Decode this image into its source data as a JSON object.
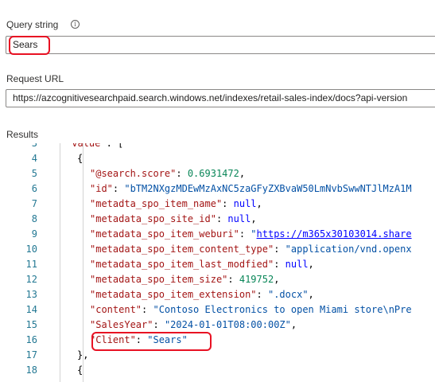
{
  "query": {
    "label": "Query string",
    "info_icon": "info-icon",
    "value": "Sears"
  },
  "request": {
    "label": "Request URL",
    "value": "https://azcognitivesearchpaid.search.windows.net/indexes/retail-sales-index/docs?api-version"
  },
  "results": {
    "label": "Results",
    "lines": [
      {
        "num": "3",
        "indent": 1,
        "parts": [
          {
            "t": "\"value\"",
            "c": "k"
          },
          {
            "t": ": [",
            "c": "p"
          }
        ]
      },
      {
        "num": "4",
        "indent": 2,
        "parts": [
          {
            "t": "{",
            "c": "p"
          }
        ]
      },
      {
        "num": "5",
        "indent": 3,
        "parts": [
          {
            "t": "\"@search.score\"",
            "c": "k"
          },
          {
            "t": ": ",
            "c": "p"
          },
          {
            "t": "0.6931472",
            "c": "n"
          },
          {
            "t": ",",
            "c": "p"
          }
        ]
      },
      {
        "num": "6",
        "indent": 3,
        "parts": [
          {
            "t": "\"id\"",
            "c": "k"
          },
          {
            "t": ": ",
            "c": "p"
          },
          {
            "t": "\"bTM2NXgzMDEwMzAxNC5zaGFyZXBvaW50LmNvbSwwNTJlMzA1M",
            "c": "s"
          }
        ]
      },
      {
        "num": "7",
        "indent": 3,
        "parts": [
          {
            "t": "\"metadta_spo_item_name\"",
            "c": "k"
          },
          {
            "t": ": ",
            "c": "p"
          },
          {
            "t": "null",
            "c": "kw"
          },
          {
            "t": ",",
            "c": "p"
          }
        ]
      },
      {
        "num": "8",
        "indent": 3,
        "parts": [
          {
            "t": "\"metadata_spo_site_id\"",
            "c": "k"
          },
          {
            "t": ": ",
            "c": "p"
          },
          {
            "t": "null",
            "c": "kw"
          },
          {
            "t": ",",
            "c": "p"
          }
        ]
      },
      {
        "num": "9",
        "indent": 3,
        "parts": [
          {
            "t": "\"metadata_spo_item_weburi\"",
            "c": "k"
          },
          {
            "t": ": ",
            "c": "p"
          },
          {
            "t": "\"",
            "c": "s"
          },
          {
            "t": "https://m365x30103014.share",
            "c": "u"
          }
        ]
      },
      {
        "num": "10",
        "indent": 3,
        "parts": [
          {
            "t": "\"metadata_spo_item_content_type\"",
            "c": "k"
          },
          {
            "t": ": ",
            "c": "p"
          },
          {
            "t": "\"application/vnd.openx",
            "c": "s"
          }
        ]
      },
      {
        "num": "11",
        "indent": 3,
        "parts": [
          {
            "t": "\"metadata_spo_item_last_modfied\"",
            "c": "k"
          },
          {
            "t": ": ",
            "c": "p"
          },
          {
            "t": "null",
            "c": "kw"
          },
          {
            "t": ",",
            "c": "p"
          }
        ]
      },
      {
        "num": "12",
        "indent": 3,
        "parts": [
          {
            "t": "\"metadata_spo_item_size\"",
            "c": "k"
          },
          {
            "t": ": ",
            "c": "p"
          },
          {
            "t": "419752",
            "c": "n"
          },
          {
            "t": ",",
            "c": "p"
          }
        ]
      },
      {
        "num": "13",
        "indent": 3,
        "parts": [
          {
            "t": "\"metadata_spo_item_extension\"",
            "c": "k"
          },
          {
            "t": ": ",
            "c": "p"
          },
          {
            "t": "\".docx\"",
            "c": "s"
          },
          {
            "t": ",",
            "c": "p"
          }
        ]
      },
      {
        "num": "14",
        "indent": 3,
        "parts": [
          {
            "t": "\"content\"",
            "c": "k"
          },
          {
            "t": ": ",
            "c": "p"
          },
          {
            "t": "\"Contoso Electronics to open Miami store\\nPre",
            "c": "s"
          }
        ]
      },
      {
        "num": "15",
        "indent": 3,
        "parts": [
          {
            "t": "\"SalesYear\"",
            "c": "k"
          },
          {
            "t": ": ",
            "c": "p"
          },
          {
            "t": "\"2024-01-01T08:00:00Z\"",
            "c": "s"
          },
          {
            "t": ",",
            "c": "p"
          }
        ]
      },
      {
        "num": "16",
        "indent": 3,
        "parts": [
          {
            "t": "\"Client\"",
            "c": "k"
          },
          {
            "t": ": ",
            "c": "p"
          },
          {
            "t": "\"Sears\"",
            "c": "s"
          }
        ]
      },
      {
        "num": "17",
        "indent": 2,
        "parts": [
          {
            "t": "},",
            "c": "p"
          }
        ]
      },
      {
        "num": "18",
        "indent": 2,
        "parts": [
          {
            "t": "{",
            "c": "p"
          }
        ]
      }
    ]
  }
}
